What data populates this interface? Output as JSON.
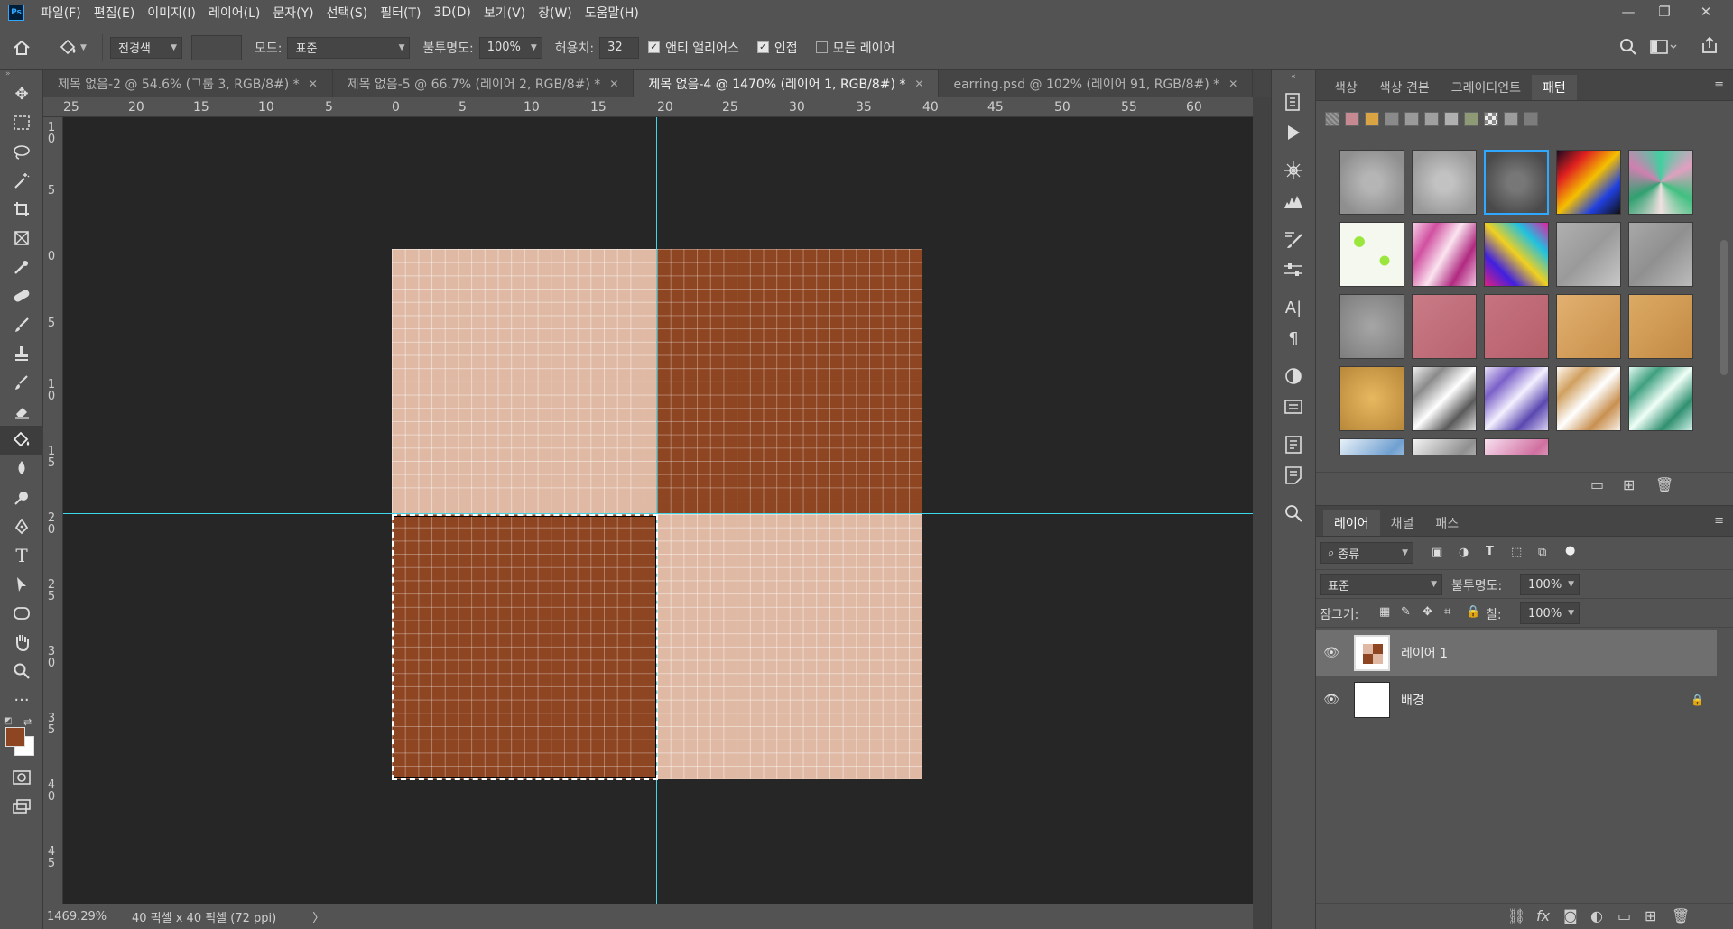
{
  "app": {
    "logo": "Ps"
  },
  "menu": [
    "파일(F)",
    "편집(E)",
    "이미지(I)",
    "레이어(L)",
    "문자(Y)",
    "선택(S)",
    "필터(T)",
    "3D(D)",
    "보기(V)",
    "창(W)",
    "도움말(H)"
  ],
  "window_controls": {
    "minimize": "—",
    "restore": "❐",
    "close": "✕"
  },
  "options": {
    "home_icon": "home-icon",
    "fill_source": "전경색",
    "mode_label": "모드:",
    "mode_value": "표준",
    "opacity_label": "불투명도:",
    "opacity_value": "100%",
    "tolerance_label": "허용치:",
    "tolerance_value": "32",
    "antialias_label": "앤티 앨리어스",
    "antialias_checked": true,
    "contiguous_label": "인접",
    "contiguous_checked": true,
    "all_layers_label": "모든 레이어",
    "all_layers_checked": false
  },
  "tabs": [
    {
      "label": "제목 없음-2 @ 54.6% (그룹 3, RGB/8#) *",
      "active": false
    },
    {
      "label": "제목 없음-5 @ 66.7% (레이어 2, RGB/8#) *",
      "active": false
    },
    {
      "label": "제목 없음-4 @ 1470% (레이어 1, RGB/8#) *",
      "active": true
    },
    {
      "label": "earring.psd @ 102% (레이어 91, RGB/8#) *",
      "active": false
    }
  ],
  "ruler_top": [
    "25",
    "20",
    "15",
    "10",
    "5",
    "0",
    "5",
    "10",
    "15",
    "20",
    "25",
    "30",
    "35",
    "40",
    "45",
    "50",
    "55",
    "60"
  ],
  "ruler_left": [
    "1\n0",
    "5",
    "0",
    "5",
    "1\n0",
    "1\n5",
    "2\n0",
    "2\n5",
    "3\n0",
    "3\n5",
    "4\n0",
    "4\n5"
  ],
  "canvas": {
    "colors": {
      "light": "#dfb9a4",
      "dark": "#8e4522",
      "guide": "#3ed6e8",
      "background": "#262626"
    }
  },
  "status": {
    "zoom": "1469.29%",
    "doc_info": "40 픽셀 x 40 픽셀 (72 ppi)",
    "arrow": "〉"
  },
  "foreground_color": "#8e4522",
  "background_color": "#ffffff",
  "pattern_panel": {
    "tabs": [
      "색상",
      "색상 견본",
      "그레이디언트",
      "패턴"
    ],
    "active_tab": "패턴",
    "menu_icon": "≡"
  },
  "layers_panel": {
    "tabs": [
      "레이어",
      "채널",
      "패스"
    ],
    "active_tab": "레이어",
    "filter_label": "종류",
    "blend_mode": "표준",
    "opacity_label": "불투명도:",
    "opacity_value": "100%",
    "lock_label": "잠그기:",
    "fill_label": "칠:",
    "fill_value": "100%",
    "layers": [
      {
        "name": "레이어 1",
        "selected": true,
        "locked": false
      },
      {
        "name": "배경",
        "selected": false,
        "locked": true
      }
    ],
    "footer_icons": [
      "link-icon",
      "fx-icon",
      "mask-icon",
      "adjustment-icon",
      "folder-icon",
      "new-layer-icon",
      "trash-icon"
    ]
  }
}
